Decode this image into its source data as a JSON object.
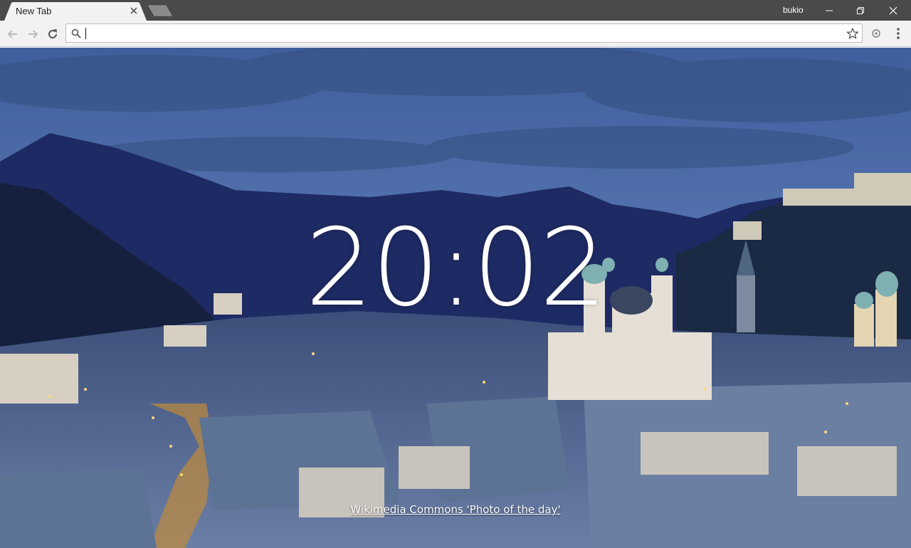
{
  "browser": {
    "tab": {
      "title": "New Tab"
    },
    "profile_name": "bukio",
    "omnibox": {
      "value": "",
      "placeholder": ""
    },
    "icons": {
      "back": "arrow-left-icon",
      "forward": "arrow-right-icon",
      "reload": "reload-icon",
      "search": "search-icon",
      "bookmark": "star-icon",
      "extension": "extension-icon",
      "menu": "kebab-menu-icon",
      "minimize": "minimize-icon",
      "restore": "restore-icon",
      "close": "close-icon"
    }
  },
  "newtab": {
    "clock": "20:02",
    "photo_credit": "Wikimedia Commons 'Photo of the day'"
  },
  "colors": {
    "titlebar": "#4a4a48",
    "toolbar": "#f2f2f2",
    "clock_text": "#ffffff"
  }
}
